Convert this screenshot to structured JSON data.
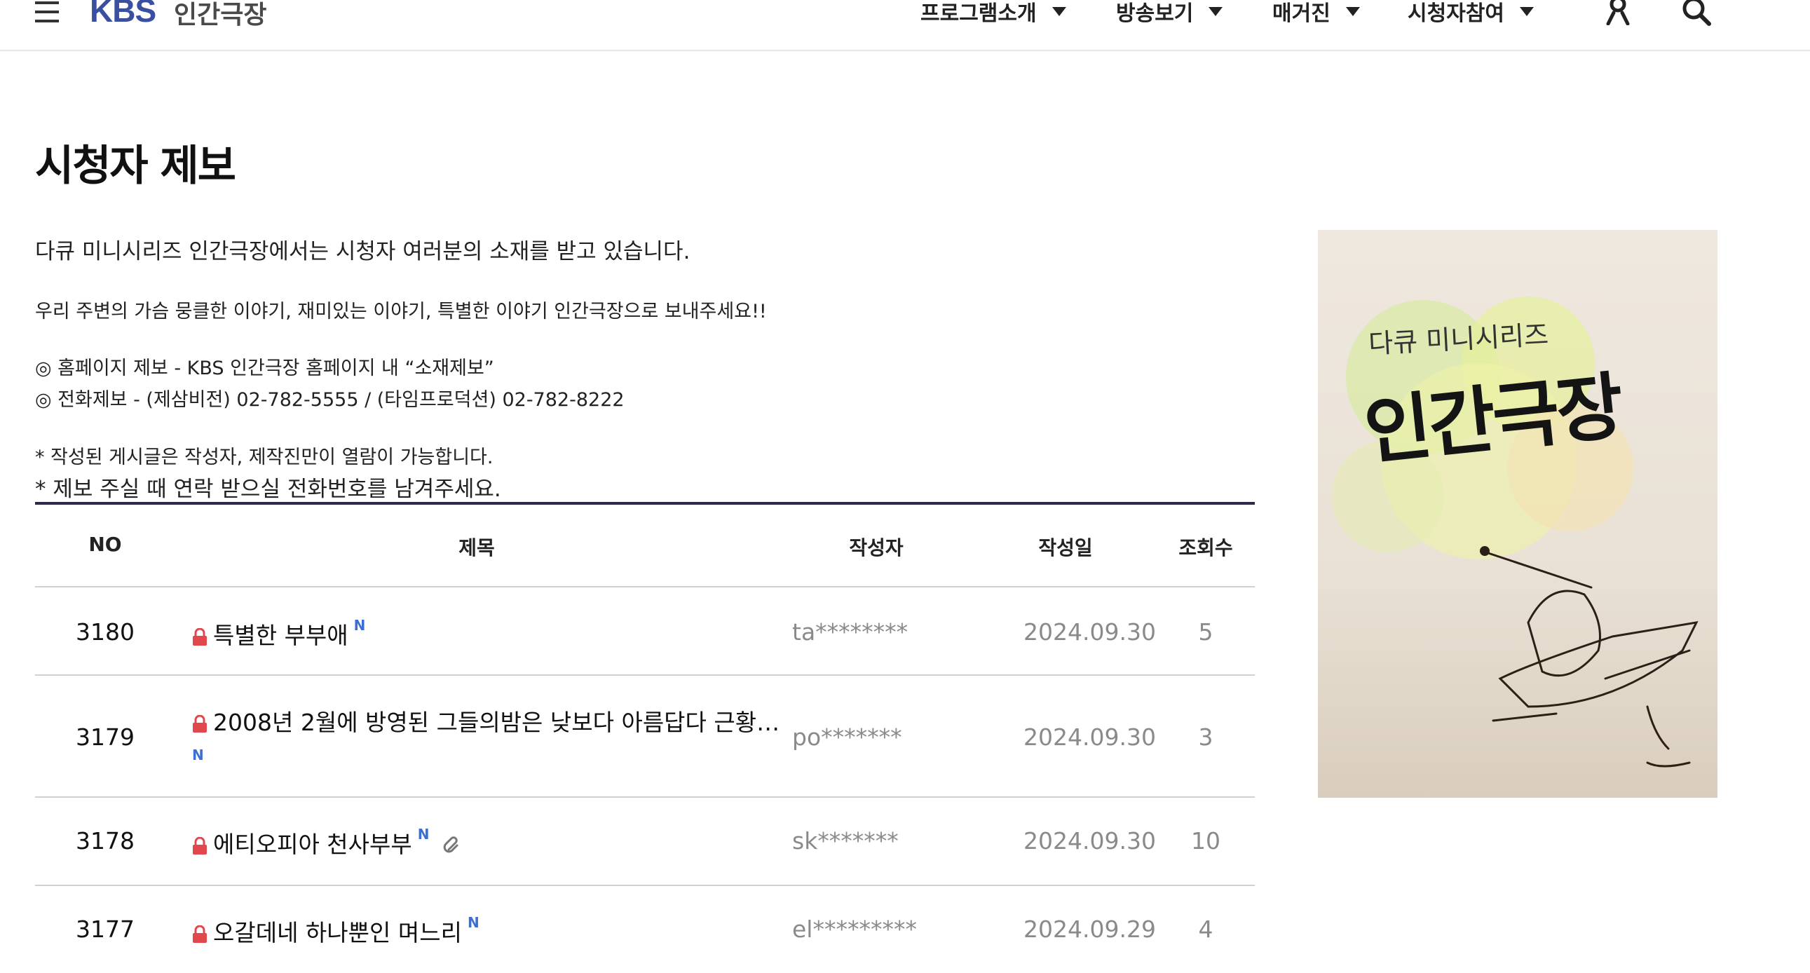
{
  "header": {
    "logo_brand": "KBS",
    "logo_program": "인간극장",
    "nav": [
      {
        "label": "프로그램소개"
      },
      {
        "label": "방송보기"
      },
      {
        "label": "매거진"
      },
      {
        "label": "시청자참여"
      }
    ],
    "icons": [
      "menu-icon",
      "user-icon",
      "search-icon"
    ]
  },
  "page": {
    "title": "시청자 제보",
    "intro_1": "다큐 미니시리즈 인간극장에서는 시청자 여러분의 소재를 받고 있습니다.",
    "intro_2": "우리 주변의 가슴 뭉클한 이야기, 재미있는 이야기, 특별한 이야기 인간극장으로 보내주세요!!",
    "intro_3": "◎ 홈페이지 제보 - KBS 인간극장 홈페이지 내 “소재제보”",
    "intro_4": "◎ 전화제보 - (제삼비전) 02-782-5555 / (타임프로덕션) 02-782-8222",
    "intro_5": "* 작성된 게시글은 작성자, 제작진만이 열람이 가능합니다.",
    "intro_6": "* 제보 주실 때 연락 받으실 전화번호를 남겨주세요."
  },
  "poster": {
    "subtitle": "다큐 미니시리즈",
    "title": "인간극장"
  },
  "table": {
    "headers": {
      "no": "NO",
      "title": "제목",
      "writer": "작성자",
      "date": "작성일",
      "views": "조회수"
    },
    "new_badge": "N",
    "rows": [
      {
        "no": "3180",
        "title": "특별한 부부애",
        "writer": "ta********",
        "date": "2024.09.30",
        "views": "5"
      },
      {
        "no": "3179",
        "title": "2008년 2월에 방영된 그들의밤은 낮보다 아름답다 근황…",
        "writer": "po*******",
        "date": "2024.09.30",
        "views": "3"
      },
      {
        "no": "3178",
        "title": "에티오피아 천사부부",
        "writer": "sk*******",
        "date": "2024.09.30",
        "views": "10"
      },
      {
        "no": "3177",
        "title": "오갈데네 하나뿐인 며느리",
        "writer": "el*********",
        "date": "2024.09.29",
        "views": "4"
      }
    ]
  },
  "colors": {
    "brand": "#3b4fa0",
    "table_top_line": "#2b2a4c",
    "new_badge": "#3b6fd1",
    "lock": "#e0484d"
  }
}
